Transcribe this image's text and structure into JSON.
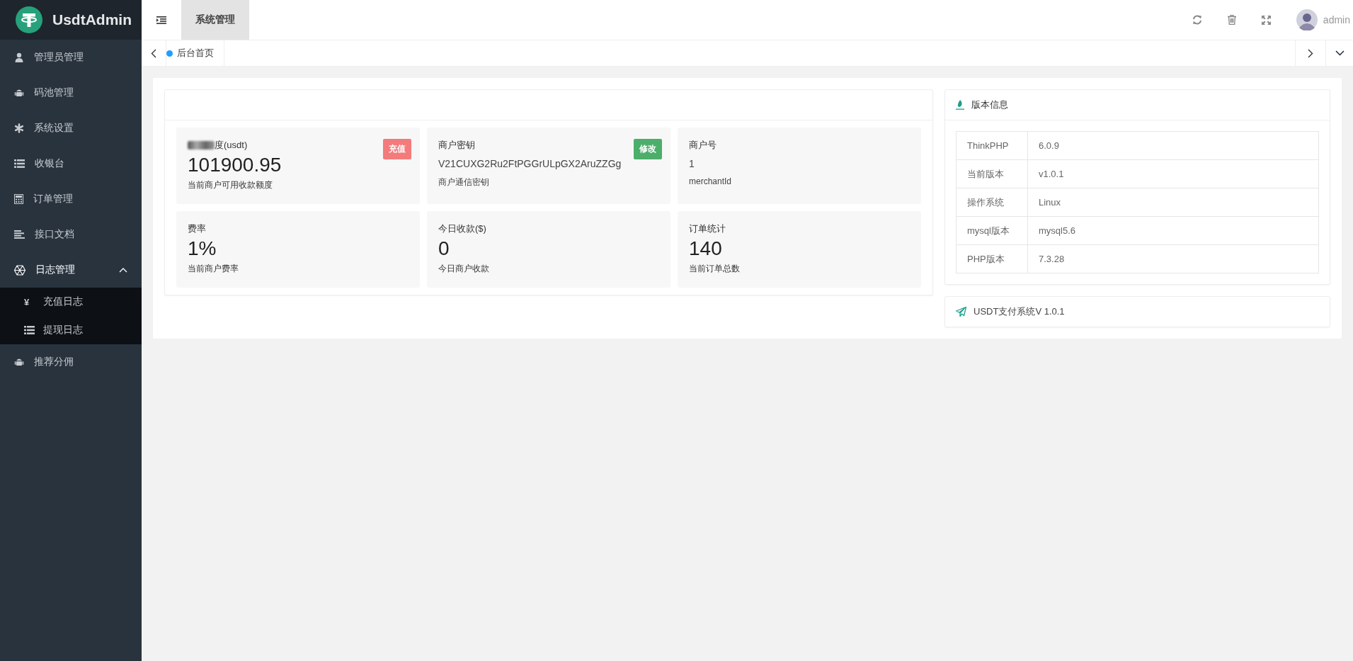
{
  "sidebar": {
    "logo": "UsdtAdmin",
    "items": [
      {
        "label": "管理员管理"
      },
      {
        "label": "码池管理"
      },
      {
        "label": "系统设置"
      },
      {
        "label": "收银台"
      },
      {
        "label": "订单管理"
      },
      {
        "label": "接口文档"
      },
      {
        "label": "日志管理",
        "expanded": true,
        "children": [
          {
            "icon": "¥",
            "label": "充值日志"
          },
          {
            "label": "提现日志"
          }
        ]
      },
      {
        "label": "推荐分佣"
      }
    ]
  },
  "header": {
    "menus": [
      {
        "label": "系统管理",
        "selected": true
      }
    ],
    "user": "admin"
  },
  "tabs": [
    {
      "label": "后台首页",
      "selected": true
    }
  ],
  "stats": [
    {
      "title": "度(usdt)",
      "value": "101900.95",
      "caption": "当前商户可用收款额度",
      "kind": "large",
      "button": {
        "label": "充值",
        "color": "#f37b7b"
      }
    },
    {
      "title": "商户密钥",
      "value": "V21CUXG2Ru2FtPGGrULpGX2AruZZGg",
      "caption": "商户通信密钥",
      "kind": "small",
      "button": {
        "label": "修改",
        "color": "#4cae6a"
      }
    },
    {
      "title": "商户号",
      "value": "1",
      "caption": "merchantId",
      "kind": "small"
    },
    {
      "title": "费率",
      "value": "1%",
      "caption": "当前商户费率",
      "kind": "large"
    },
    {
      "title": "今日收款($)",
      "value": "0",
      "caption": "今日商户收款",
      "kind": "large"
    },
    {
      "title": "订单统计",
      "value": "140",
      "caption": "当前订单总数",
      "kind": "large"
    }
  ],
  "version": {
    "title": "版本信息",
    "rows": [
      {
        "name": "ThinkPHP",
        "value": "6.0.9"
      },
      {
        "name": "当前版本",
        "value": "v1.0.1"
      },
      {
        "name": "操作系统",
        "value": "Linux"
      },
      {
        "name": "mysql版本",
        "value": "mysql5.6"
      },
      {
        "name": "PHP版本",
        "value": "7.3.28"
      }
    ]
  },
  "footer_card": {
    "text": "USDT支付系统V 1.0.1"
  }
}
